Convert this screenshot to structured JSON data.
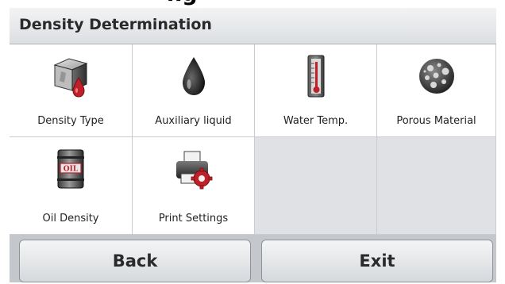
{
  "page_heading_partial": "ng",
  "screen": {
    "title": "Density Determination"
  },
  "menu_items": [
    {
      "label": "Density Type",
      "icon": "density-cube-icon"
    },
    {
      "label": "Auxiliary liquid",
      "icon": "liquid-drop-icon"
    },
    {
      "label": "Water Temp.",
      "icon": "thermometer-icon"
    },
    {
      "label": "Porous Material",
      "icon": "porous-sphere-icon"
    },
    {
      "label": "Oil Density",
      "icon": "oil-barrel-icon"
    },
    {
      "label": "Print Settings",
      "icon": "printer-gear-icon"
    }
  ],
  "buttons": {
    "back": "Back",
    "exit": "Exit"
  },
  "colors": {
    "accent_red": "#c0202a",
    "frame_gray": "#c4c7cb",
    "empty_cell": "#dfe1e4"
  }
}
